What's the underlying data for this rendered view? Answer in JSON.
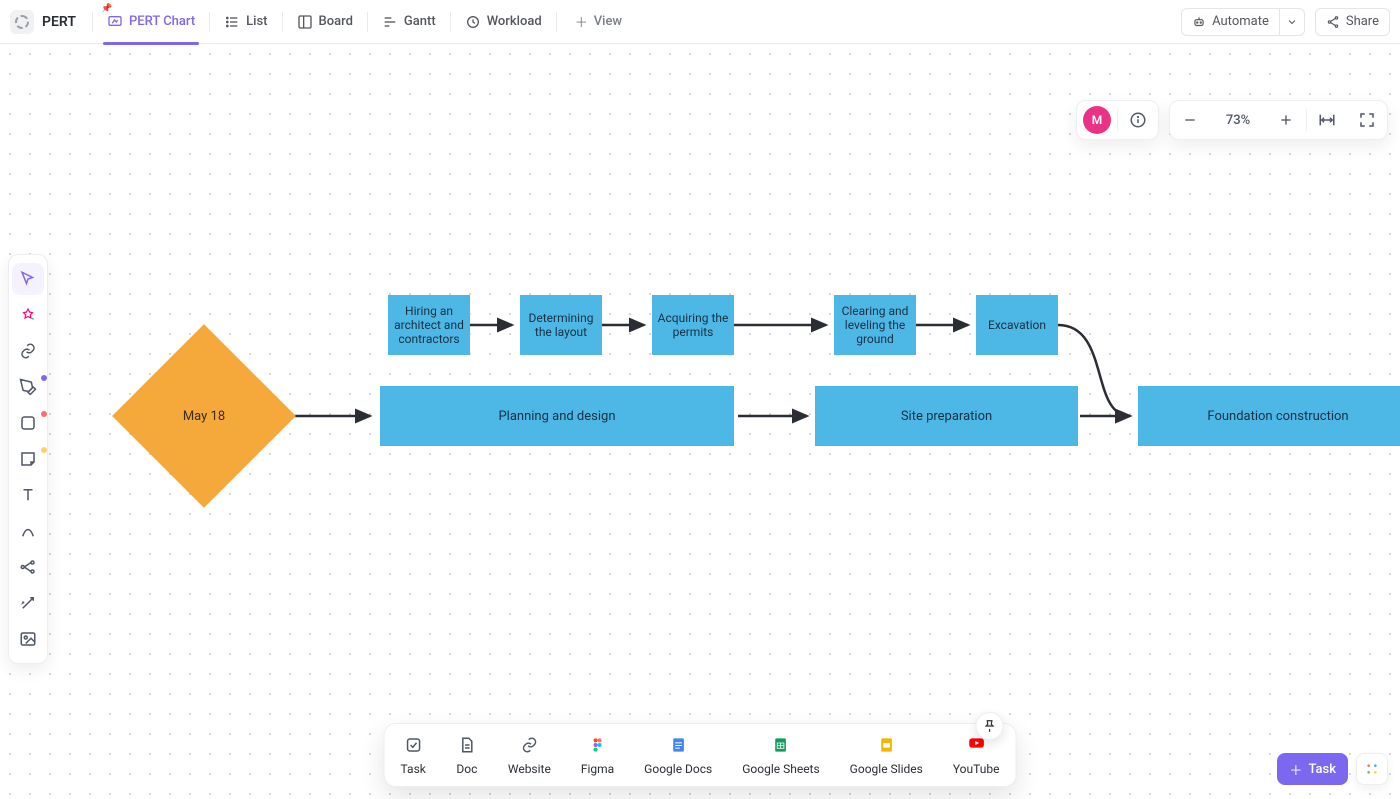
{
  "project": {
    "title": "PERT"
  },
  "tabs": [
    {
      "label": "PERT Chart",
      "active": true,
      "pinned": true
    },
    {
      "label": "List"
    },
    {
      "label": "Board"
    },
    {
      "label": "Gantt"
    },
    {
      "label": "Workload"
    }
  ],
  "add_view_label": "View",
  "header_actions": {
    "automate": "Automate",
    "share": "Share"
  },
  "zoom": {
    "pct": "73%"
  },
  "avatar": {
    "letter": "M"
  },
  "dock": [
    {
      "label": "Task"
    },
    {
      "label": "Doc"
    },
    {
      "label": "Website"
    },
    {
      "label": "Figma"
    },
    {
      "label": "Google Docs"
    },
    {
      "label": "Google Sheets"
    },
    {
      "label": "Google Slides"
    },
    {
      "label": "YouTube"
    }
  ],
  "new_task": {
    "label": "Task"
  },
  "diagram": {
    "start": {
      "label": "May 18"
    },
    "sub_tasks": [
      {
        "label": "Hiring an architect and contractors"
      },
      {
        "label": "Determining the layout"
      },
      {
        "label": "Acquiring the permits"
      },
      {
        "label": "Clearing and leveling the ground"
      },
      {
        "label": "Excavation"
      }
    ],
    "phases": [
      {
        "label": "Planning and design"
      },
      {
        "label": "Site preparation"
      },
      {
        "label": "Foundation construction"
      }
    ]
  }
}
